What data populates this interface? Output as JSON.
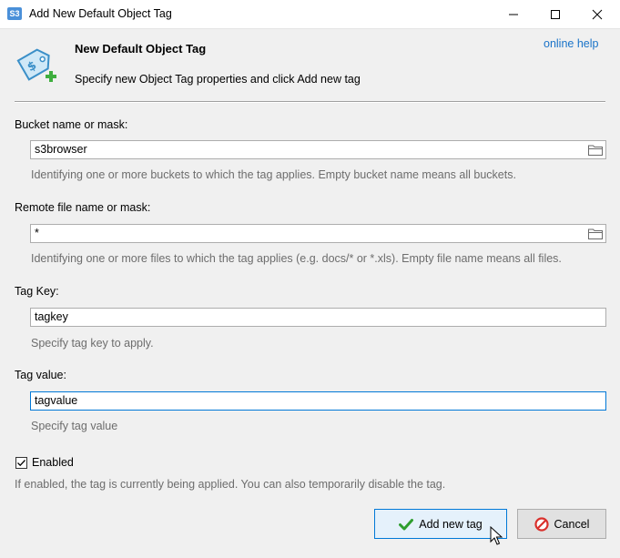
{
  "window": {
    "app_icon_text": "S3",
    "title": "Add New Default Object Tag"
  },
  "header": {
    "title": "New Default Object Tag",
    "subtitle": "Specify new Object Tag properties and click Add new tag",
    "online_help": "online help"
  },
  "fields": {
    "bucket": {
      "label": "Bucket name or mask:",
      "value": "s3browser",
      "hint": "Identifying one or more buckets to which the tag applies. Empty bucket name means all buckets."
    },
    "remote_file": {
      "label": "Remote file name or mask:",
      "value": "*",
      "hint": "Identifying one or more files to which the tag applies (e.g. docs/* or *.xls). Empty file name means all files."
    },
    "tag_key": {
      "label": "Tag Key:",
      "value": "tagkey",
      "hint": "Specify tag key to apply."
    },
    "tag_value": {
      "label": "Tag value:",
      "value": "tagvalue",
      "hint": "Specify tag value"
    }
  },
  "enabled": {
    "label": "Enabled",
    "checked": true,
    "hint": "If enabled, the tag is currently being applied. You can also temporarily disable the tag."
  },
  "buttons": {
    "add_label": "Add new tag",
    "cancel_label": "Cancel"
  },
  "colors": {
    "accent": "#0078d7",
    "link": "#1a73c8",
    "hint_text": "#6d6d6d",
    "check_green": "#2e9e2e",
    "cancel_red": "#d9302c"
  }
}
